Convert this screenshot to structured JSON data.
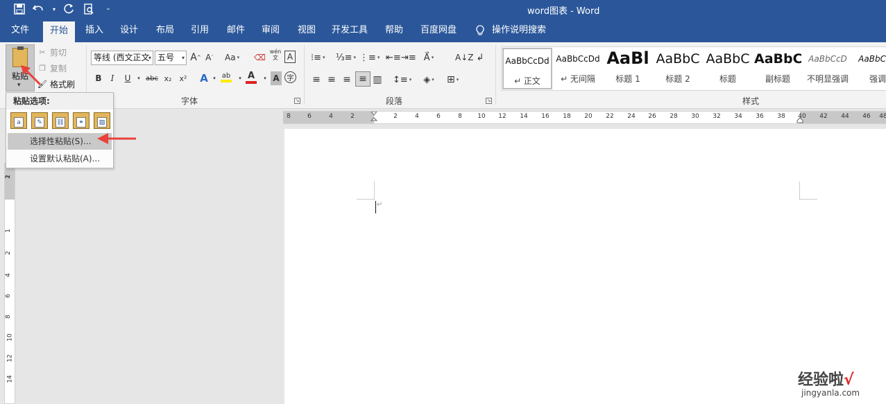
{
  "title_bar": {
    "title": "word图表  -  Word"
  },
  "qat": {
    "icons": [
      "save-icon",
      "undo-icon",
      "redo-icon",
      "print-preview-icon",
      "customize-qat-icon"
    ]
  },
  "tabs": [
    {
      "label": "文件"
    },
    {
      "label": "开始"
    },
    {
      "label": "插入"
    },
    {
      "label": "设计"
    },
    {
      "label": "布局"
    },
    {
      "label": "引用"
    },
    {
      "label": "邮件"
    },
    {
      "label": "审阅"
    },
    {
      "label": "视图"
    },
    {
      "label": "开发工具"
    },
    {
      "label": "帮助"
    },
    {
      "label": "百度网盘"
    },
    {
      "label": "操作说明搜索"
    }
  ],
  "active_tab": "开始",
  "clipboard": {
    "paste_label": "粘贴",
    "cut_label": "剪切",
    "copy_label": "复制",
    "format_painter_label": "格式刷"
  },
  "font": {
    "font_name": "等线 (西文正文",
    "font_size": "五号",
    "group_label": "字体",
    "change_case": "Aa",
    "bold": "B",
    "italic": "I",
    "underline": "U",
    "strike": "abc",
    "subscript": "x₂",
    "superscript": "x²",
    "text_effects": "A",
    "highlight": "ab",
    "font_color": "A",
    "shading": "A",
    "char_border": "A",
    "phonetic": "wén\n文"
  },
  "paragraph": {
    "group_label": "段落"
  },
  "styles": {
    "group_label": "样式",
    "items": [
      {
        "sample": "AaBbCcDd",
        "name": "↵ 正文"
      },
      {
        "sample": "AaBbCcDd",
        "name": "↵ 无间隔"
      },
      {
        "sample": "AaBl",
        "name": "标题 1"
      },
      {
        "sample": "AaBbC",
        "name": "标题 2"
      },
      {
        "sample": "AaBbC",
        "name": "标题"
      },
      {
        "sample": "AaBbC",
        "name": "副标题"
      },
      {
        "sample": "AaBbCcD",
        "name": "不明显强调"
      },
      {
        "sample": "AaBbCcD",
        "name": "强调"
      }
    ]
  },
  "ruler": {
    "left_ticks": [
      "8",
      "6",
      "4",
      "2"
    ],
    "right_ticks": [
      "2",
      "4",
      "6",
      "8",
      "10",
      "12",
      "14",
      "16",
      "18",
      "20",
      "22",
      "24",
      "26",
      "28",
      "30",
      "32",
      "34",
      "36",
      "38",
      "40",
      "42",
      "44",
      "46",
      "48"
    ],
    "vertical_ticks": [
      "1",
      "2",
      "1",
      "2",
      "4",
      "6",
      "8",
      "10",
      "12",
      "14"
    ]
  },
  "paste_menu": {
    "header": "粘贴选项:",
    "options": [
      "keep-source-formatting-icon",
      "merge-formatting-icon",
      "use-destination-style-icon",
      "link-keep-source-icon",
      "picture-icon"
    ],
    "paste_special": "选择性粘贴(S)...",
    "set_default_paste": "设置默认粘贴(A)..."
  },
  "watermark": {
    "text": "经验啦",
    "check": "√",
    "url": "jingyanla.com"
  },
  "colors": {
    "accent": "#2b579a",
    "arrow": "#e8423a",
    "ribbon": "#f3f3f3",
    "workspace": "#e6e6e6"
  }
}
